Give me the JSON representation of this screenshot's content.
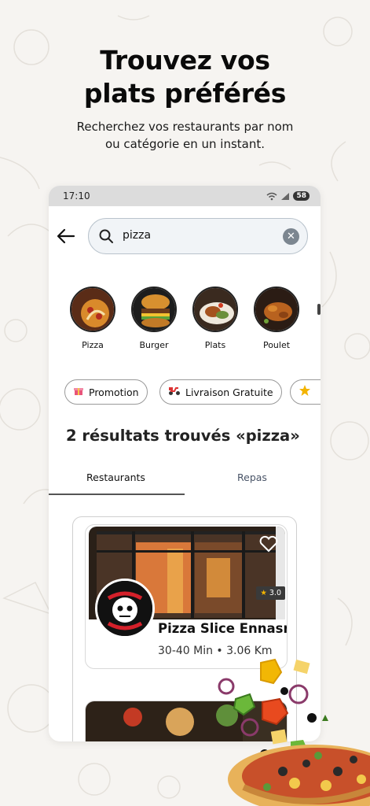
{
  "headline": {
    "line1": "Trouvez vos",
    "line2": "plats préférés"
  },
  "subline": {
    "line1": "Recherchez vos restaurants par nom",
    "line2": "ou catégorie en un instant."
  },
  "statusbar": {
    "time": "17:10",
    "battery": "58"
  },
  "search": {
    "value": "pizza"
  },
  "categories": [
    {
      "label": "Pizza"
    },
    {
      "label": "Burger"
    },
    {
      "label": "Plats"
    },
    {
      "label": "Poulet"
    }
  ],
  "chips": [
    {
      "label": "Promotion",
      "icon": "gift-icon"
    },
    {
      "label": "Livraison Gratuite",
      "icon": "scooter-icon"
    },
    {
      "label": "",
      "icon": "star-icon"
    }
  ],
  "results": {
    "title": "2 résultats trouvés «pizza»"
  },
  "tabs": [
    {
      "label": "Restaurants"
    },
    {
      "label": "Repas"
    }
  ],
  "restaurant": {
    "name": "Pizza Slice Ennasr",
    "meta": "30-40 Min • 3.06 Km",
    "rating": "3.0"
  },
  "colors": {
    "accent_star": "#f3b400",
    "tab_text_inactive": "#4a5568",
    "clear_button": "#7c8690"
  }
}
